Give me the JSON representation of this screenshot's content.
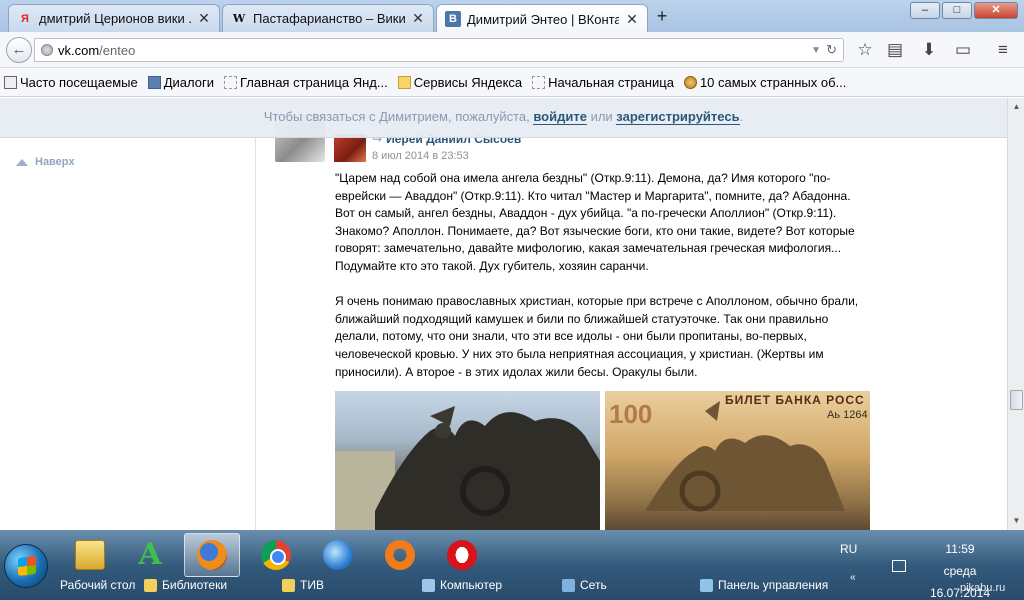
{
  "tabs": [
    {
      "favicon": "yandex-icon",
      "favicon_glyph": "Я",
      "favicon_color": "#e52620",
      "title": "дмитрий Церионов вики ..."
    },
    {
      "favicon": "wikipedia-icon",
      "favicon_glyph": "W",
      "favicon_color": "#000000",
      "title": "Пастафарианство – Вики..."
    },
    {
      "favicon": "vk-icon",
      "favicon_glyph": "В",
      "favicon_color": "#4a76a8",
      "title": "Димитрий Энтео | ВКонта..."
    }
  ],
  "window": {
    "minimize": "–",
    "maximize": "□",
    "close": "✕"
  },
  "address": {
    "host": "vk.com",
    "path": "/enteo"
  },
  "bookmarks": [
    {
      "icon": "pin-icon",
      "label": "Часто посещаемые"
    },
    {
      "icon": "chat-icon",
      "label": "Диалоги"
    },
    {
      "icon": "page-icon",
      "label": "Главная страница Янд..."
    },
    {
      "icon": "folder-icon",
      "label": "Сервисы Яндекса"
    },
    {
      "icon": "page-icon",
      "label": "Начальная страница"
    },
    {
      "icon": "coin-icon",
      "label": "10 самых странных об..."
    }
  ],
  "notice": {
    "prefix": "Чтобы связаться с Димитрием, пожалуйста, ",
    "login": "войдите",
    "middle": " или ",
    "register": "зарегистрируйтесь",
    "suffix": "."
  },
  "sidebar": {
    "up_label": "Наверх"
  },
  "post": {
    "author": "Иерей Даниил Сысоев",
    "date": "8 июл 2014 в 23:53",
    "paragraph1": "\"Царем над собой она имела ангела бездны\" (Откр.9:11). Демона, да? Имя которого \"по-еврейски — Аваддон\" (Откр.9:11). Кто читал \"Мастер и Маргарита\", помните, да? Абадонна. Вот он самый, ангел бездны, Аваддон - дух убийца. \"а по-гречески Аполлион\" (Откр.9:11). Знакомо? Аполлон. Понимаете, да? Вот языческие боги, кто они такие, видете? Вот которые говорят: замечательно, давайте мифологию, какая замечательная греческая мифология... Подумайте кто это такой. Дух губитель, хозяин саранчи.",
    "paragraph2": "Я очень понимаю православных христиан, которые при встрече с Аполлоном, обычно брали, ближайший подходящий камушек и били по ближайшей статуэточке. Так они правильно делали, потому, что они знали, что эти все идолы - они были пропитаны, во-первых, человеческой кровью. У них это была неприятная ассоциация, у христиан. (Жертвы им приносили). А второе - в этих идолах жили бесы. Оракулы были.",
    "banknote_text": "БИЛЕТ БАНКА РОСС",
    "banknote_serial": "Аь 1264",
    "banknote_value": "100"
  },
  "taskbar": {
    "apps": [
      {
        "name": "libraries",
        "icon": "folder-icon"
      },
      {
        "name": "aimp",
        "icon": "aimp-icon"
      },
      {
        "name": "firefox",
        "icon": "firefox-icon",
        "active": true
      },
      {
        "name": "chrome",
        "icon": "chrome-icon"
      },
      {
        "name": "ie",
        "icon": "ie-icon"
      },
      {
        "name": "avast",
        "icon": "avast-icon"
      },
      {
        "name": "opera",
        "icon": "opera-icon"
      }
    ],
    "toolbar_items": [
      "Рабочий стол",
      "Библиотеки",
      "ТИВ",
      "Компьютер",
      "Сеть",
      "Панель управления"
    ],
    "lang": "RU",
    "time": "11:59",
    "day": "среда",
    "date": "16.07.2014",
    "watermark": "pikabu.ru"
  }
}
